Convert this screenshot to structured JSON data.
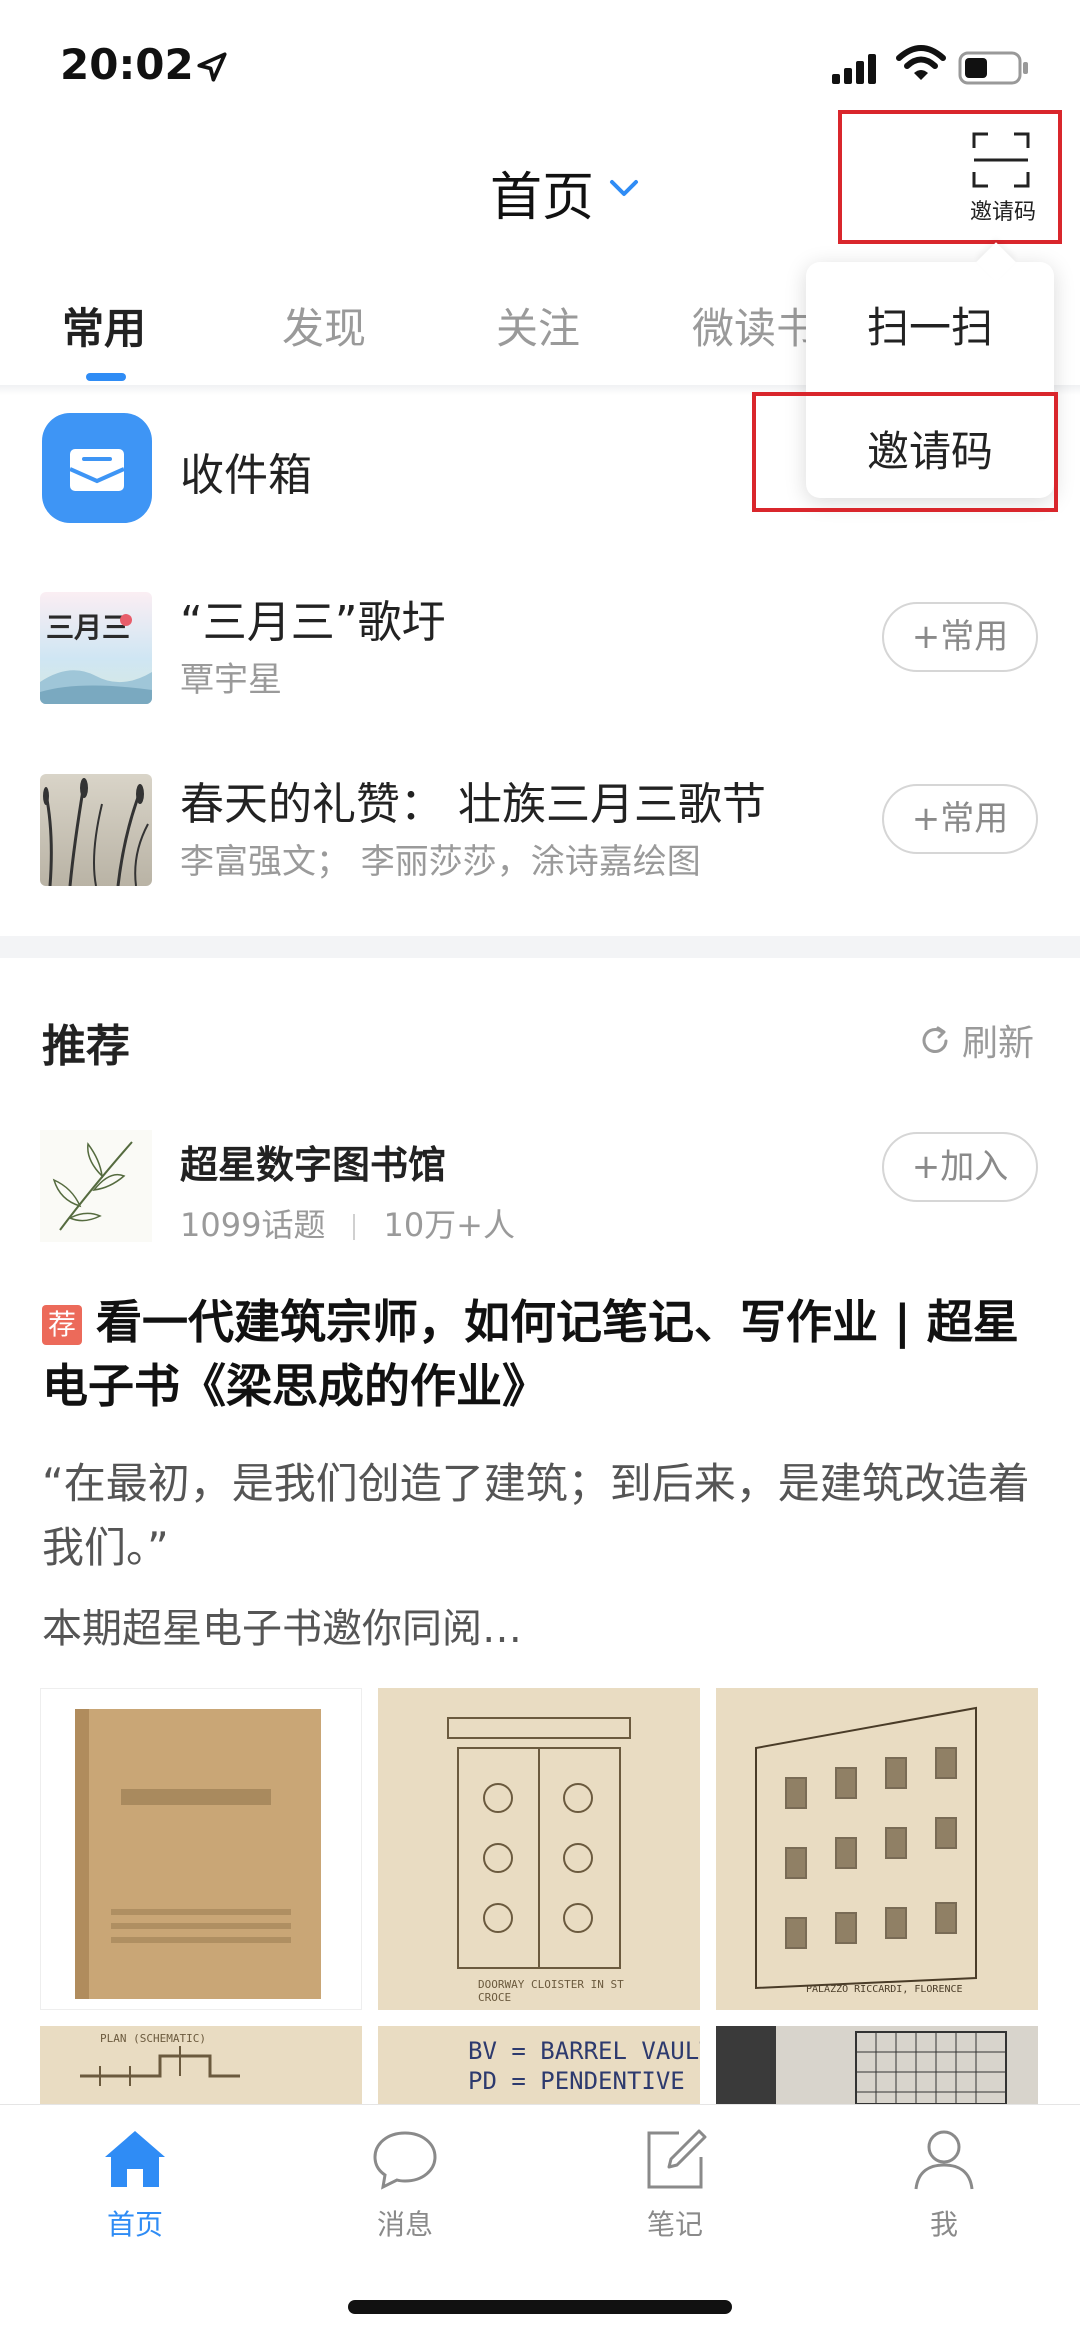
{
  "status_bar": {
    "time": "20:02"
  },
  "header": {
    "title": "首页",
    "scan_label": "邀请码"
  },
  "tabs": [
    {
      "label": "常用",
      "active": true
    },
    {
      "label": "发现",
      "active": false
    },
    {
      "label": "关注",
      "active": false
    },
    {
      "label": "微读书",
      "active": false
    }
  ],
  "dropdown": {
    "items": [
      "扫一扫",
      "邀请码"
    ]
  },
  "inbox": {
    "label": "收件箱"
  },
  "frequent": [
    {
      "title": "“三月三”歌圩",
      "author": "覃宇星",
      "button": "+常用",
      "cover_text": "三月三"
    },
    {
      "title": "春天的礼赞： 壮族三月三歌节",
      "author": "李富强文； 李丽莎莎，涂诗嘉绘图",
      "button": "+常用"
    }
  ],
  "recommend": {
    "title": "推荐",
    "refresh": "刷新",
    "library": {
      "name": "超星数字图书馆",
      "topics": "1099话题",
      "members": "10万+人",
      "button": "+加入"
    },
    "article": {
      "badge": "荐",
      "title": "看一代建筑宗师，如何记笔记、写作业 | 超星电子书《梁思成的作业》",
      "quote": "“在最初，是我们创造了建筑；到后来，是建筑改造着我们。”",
      "intro": "本期超星电子书邀你同阅…"
    },
    "images": [
      {
        "caption": ""
      },
      {
        "caption": "DOORWAY  CLOISTER  IN  ST CROCE"
      },
      {
        "caption": "PALAZZO RICCARDI, FLORENCE"
      },
      {
        "caption": "PLAN (SCHEMATIC)"
      },
      {
        "caption": "BV = BARREL VAULT.\nPD = PENDENTIVE DOME"
      },
      {
        "caption": ""
      }
    ]
  },
  "bottom_nav": [
    {
      "label": "首页",
      "active": true,
      "icon": "home-icon"
    },
    {
      "label": "消息",
      "active": false,
      "icon": "message-icon"
    },
    {
      "label": "笔记",
      "active": false,
      "icon": "note-icon"
    },
    {
      "label": "我",
      "active": false,
      "icon": "profile-icon"
    }
  ],
  "colors": {
    "accent": "#2f8cf5",
    "highlight_box": "#d9262c",
    "badge": "#ec6a5a"
  }
}
